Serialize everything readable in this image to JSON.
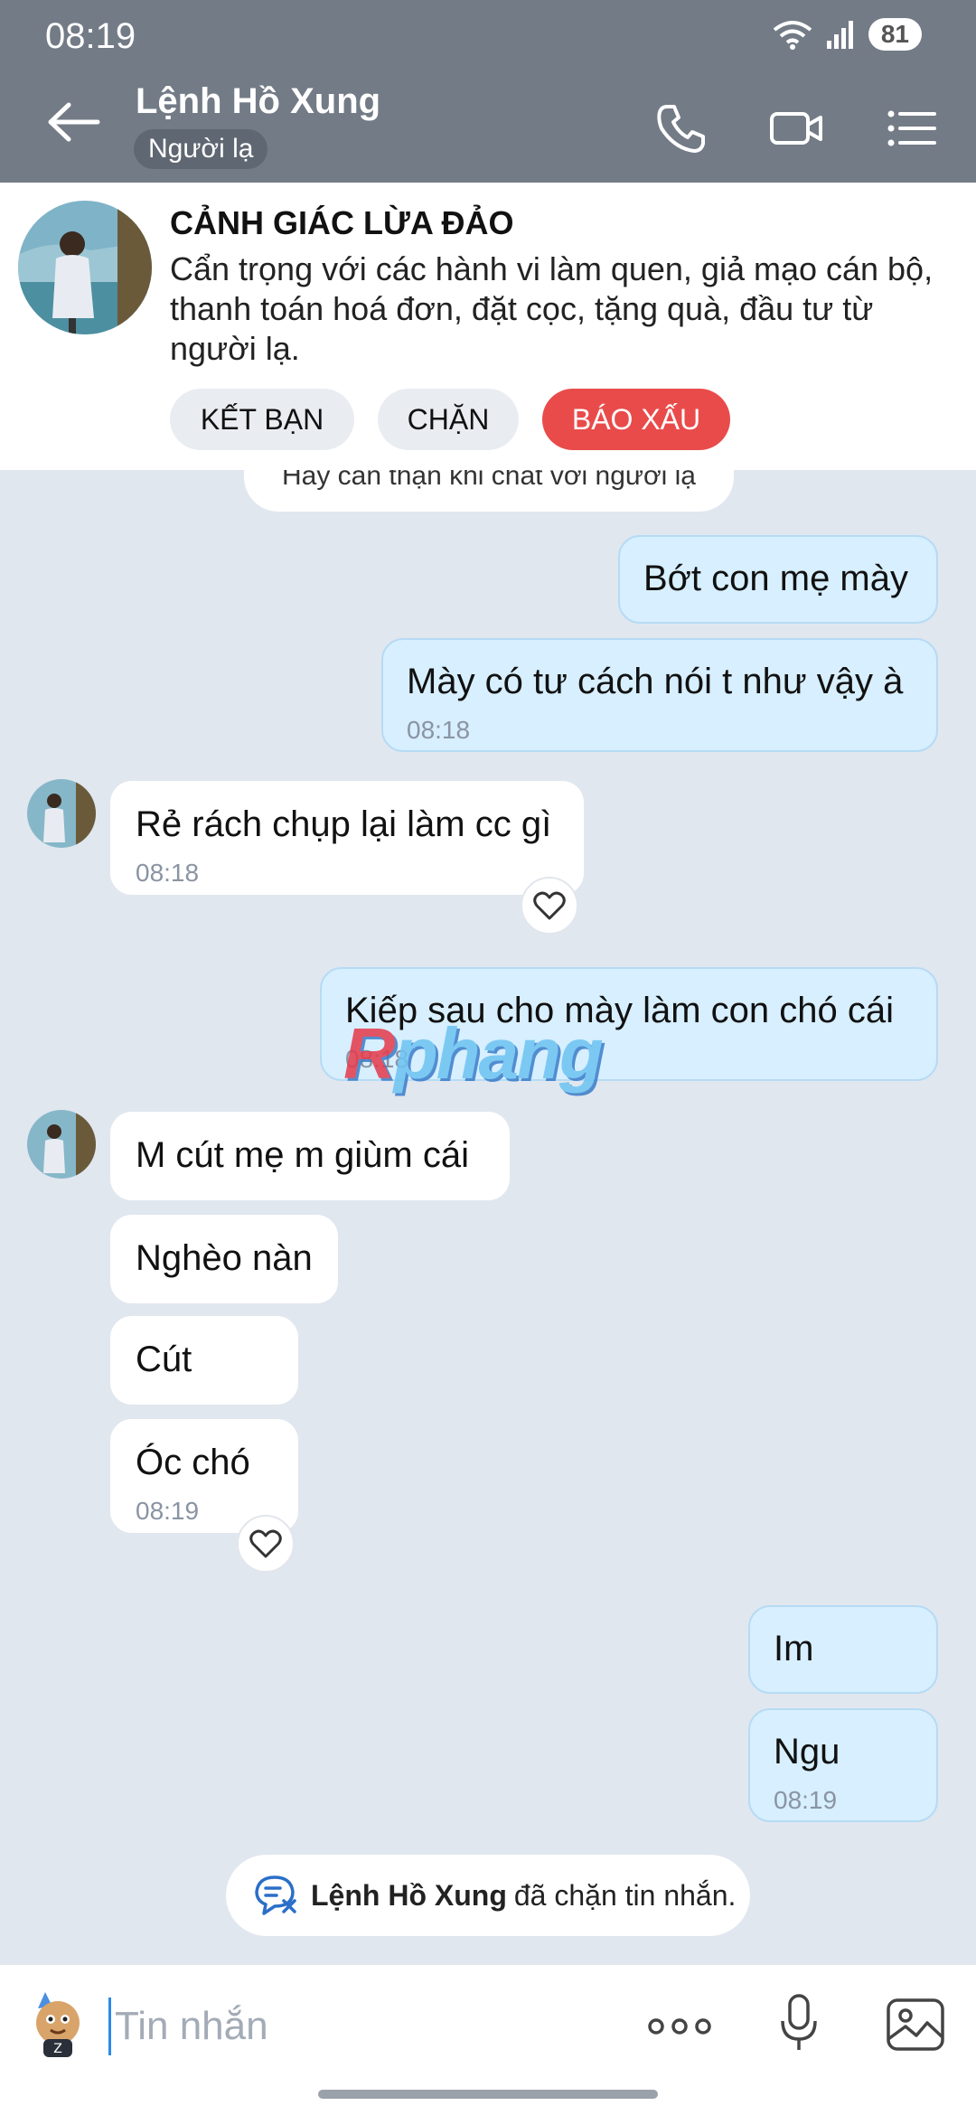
{
  "status": {
    "time": "08:19",
    "battery": "81"
  },
  "header": {
    "title": "Lệnh Hồ Xung",
    "tag": "Người lạ"
  },
  "warning": {
    "title": "CẢNH GIÁC LỪA ĐẢO",
    "body": "Cẩn trọng với các hành vi làm quen, giả mạo cán bộ, thanh toán hoá đơn, đặt cọc, tặng quà, đầu tư từ người lạ.",
    "add_friend": "KẾT BẠN",
    "block": "CHẶN",
    "report": "BÁO XẤU"
  },
  "notice": "Hãy cẩn thận khi chat với người lạ",
  "messages": [
    {
      "dir": "out",
      "text": "Bớt con mẹ mày"
    },
    {
      "dir": "out",
      "text": "Mày có tư cách nói t như vậy à",
      "time": "08:18"
    },
    {
      "dir": "in",
      "text": "Rẻ rách chụp lại làm cc gì",
      "time": "08:18"
    },
    {
      "dir": "out",
      "text": "Kiếp sau cho mày làm con chó cái",
      "time": "08:18"
    },
    {
      "dir": "in",
      "text": "M cút mẹ m giùm cái"
    },
    {
      "dir": "in",
      "text": "Nghèo nàn"
    },
    {
      "dir": "in",
      "text": "Cút"
    },
    {
      "dir": "in",
      "text": "Óc chó",
      "time": "08:19"
    },
    {
      "dir": "out",
      "text": "Im"
    },
    {
      "dir": "out",
      "text": "Ngu",
      "time": "08:19"
    }
  ],
  "watermark": {
    "r": "R",
    "rest": "phang"
  },
  "blocked": {
    "name": "Lệnh Hồ Xung",
    "text": "đã chặn tin nhắn."
  },
  "input": {
    "placeholder": "Tin nhắn"
  },
  "colors": {
    "header": "#737b86",
    "outgoing": "#d7efff",
    "report": "#e94b4b",
    "chat_bg": "#e1e7ef"
  }
}
